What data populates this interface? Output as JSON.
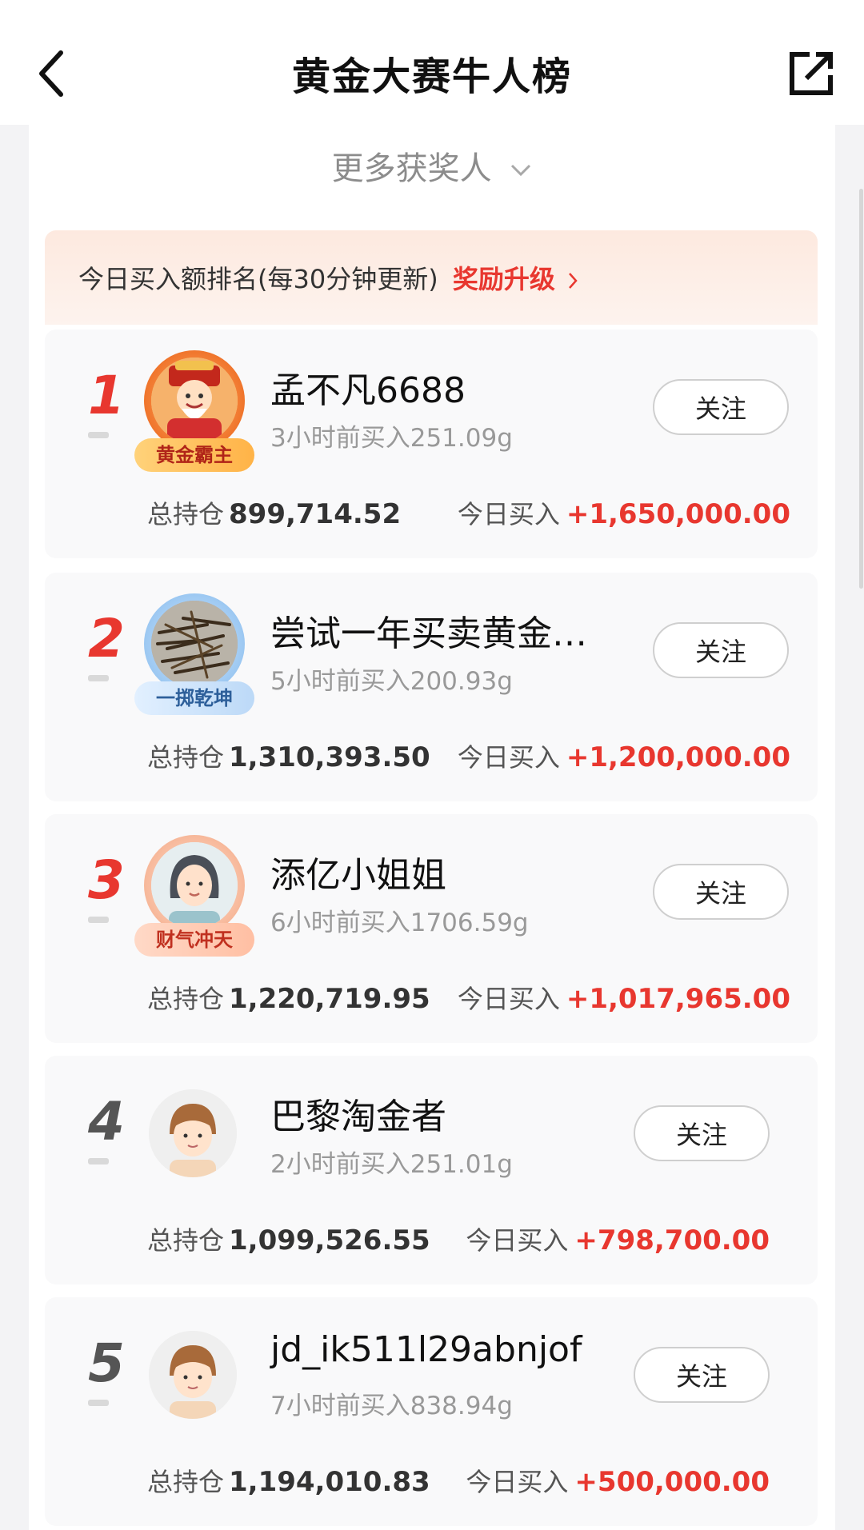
{
  "header": {
    "title": "黄金大赛牛人榜",
    "back_icon": "back-arrow-icon",
    "share_icon": "share-icon"
  },
  "more_winners": {
    "label": "更多获奖人",
    "icon": "chevron-down-icon"
  },
  "banner": {
    "text": "今日买入额排名(每30分钟更新)",
    "link": "奖励升级",
    "accent": "#e8372f"
  },
  "labels": {
    "holdings": "总持仓",
    "today_buy": "今日买入",
    "follow": "关注"
  },
  "leaders": [
    {
      "rank": "1",
      "name": "孟不凡6688",
      "time": "3小时前买入251.09g",
      "badge": "黄金霸主",
      "holdings": "899,714.52",
      "today_buy": "+1,650,000.00"
    },
    {
      "rank": "2",
      "name": "尝试一年买卖黄金…",
      "time": "5小时前买入200.93g",
      "badge": "一掷乾坤",
      "holdings": "1,310,393.50",
      "today_buy": "+1,200,000.00"
    },
    {
      "rank": "3",
      "name": "添亿小姐姐",
      "time": "6小时前买入1706.59g",
      "badge": "财气冲天",
      "holdings": "1,220,719.95",
      "today_buy": "+1,017,965.00"
    },
    {
      "rank": "4",
      "name": "巴黎淘金者",
      "time": "2小时前买入251.01g",
      "badge": "",
      "holdings": "1,099,526.55",
      "today_buy": "+798,700.00"
    },
    {
      "rank": "5",
      "name": "jd_ik511l29abnjof",
      "time": "7小时前买入838.94g",
      "badge": "",
      "holdings": "1,194,010.83",
      "today_buy": "+500,000.00"
    }
  ]
}
